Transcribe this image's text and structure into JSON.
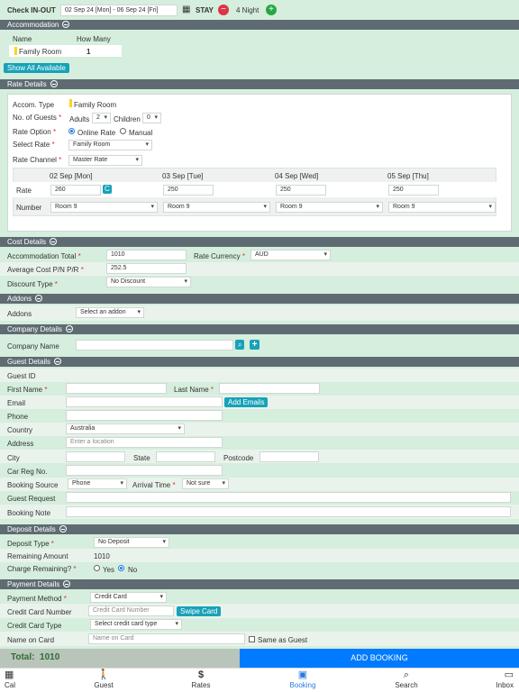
{
  "header": {
    "checkin_label": "Check IN-OUT",
    "dates": "02 Sep 24 [Mon] - 06 Sep 24 [Fri]",
    "stay_label": "STAY",
    "nights": "4 Night"
  },
  "accommodation": {
    "title": "Accommodation",
    "col_name": "Name",
    "col_count": "How Many",
    "room": "Family Room",
    "count": "1",
    "show_all": "Show All Available"
  },
  "rate_details": {
    "title": "Rate Details",
    "accom_type_label": "Accom. Type",
    "accom_type": "Family Room",
    "guests_label": "No. of Guests",
    "adults_label": "Adults",
    "adults": "2",
    "children_label": "Children",
    "children": "0",
    "rate_option_label": "Rate Option",
    "online_rate": "Online Rate",
    "manual": "Manual",
    "select_rate_label": "Select Rate",
    "select_rate": "Family Room",
    "channel_label": "Rate Channel",
    "channel": "Master Rate",
    "days": [
      "02 Sep [Mon]",
      "03 Sep [Tue]",
      "04 Sep [Wed]",
      "05 Sep [Thu]"
    ],
    "rate_label": "Rate",
    "rates": [
      "260",
      "250",
      "250",
      "250"
    ],
    "c_btn": "C",
    "number_label": "Number",
    "rooms": [
      "Room 9",
      "Room 9",
      "Room 9",
      "Room 9"
    ]
  },
  "cost": {
    "title": "Cost Details",
    "accom_total_label": "Accommodation Total",
    "accom_total": "1010",
    "currency_label": "Rate Currency",
    "currency": "AUD",
    "avg_label": "Average Cost P/N P/R",
    "avg": "252.5",
    "discount_label": "Discount Type",
    "discount": "No Discount"
  },
  "addons": {
    "title": "Addons",
    "label": "Addons",
    "select": "Select an addon"
  },
  "company": {
    "title": "Company Details",
    "label": "Company Name"
  },
  "guest": {
    "title": "Guest Details",
    "guest_id": "Guest ID",
    "first_name": "First Name",
    "last_name": "Last Name",
    "email": "Email",
    "add_emails": "Add Emails",
    "phone": "Phone",
    "country_label": "Country",
    "country": "Australia",
    "address_label": "Address",
    "address_ph": "Enter a location",
    "city": "City",
    "state": "State",
    "postcode": "Postcode",
    "car_reg": "Car Reg No.",
    "source_label": "Booking Source",
    "source": "Phone",
    "arrival_label": "Arrival Time",
    "arrival": "Not sure",
    "request": "Guest Request",
    "note": "Booking Note"
  },
  "deposit": {
    "title": "Deposit Details",
    "type_label": "Deposit Type",
    "type": "No Deposit",
    "remaining_label": "Remaining Amount",
    "remaining": "1010",
    "charge_label": "Charge Remaining?",
    "yes": "Yes",
    "no": "No"
  },
  "payment": {
    "title": "Payment Details",
    "method_label": "Payment Method",
    "method": "Credit Card",
    "cc_num_label": "Credit Card Number",
    "cc_num_ph": "Credit Card Number",
    "swipe": "Swipe Card",
    "cc_type_label": "Credit Card Type",
    "cc_type": "Select credit card type",
    "name_label": "Name on Card",
    "name_ph": "Name on Card",
    "same_as_guest": "Same as Guest"
  },
  "footer": {
    "total": "Total:  1010",
    "add_booking": "ADD BOOKING"
  },
  "nav": [
    {
      "label": "Cal",
      "icon": "calendar-icon"
    },
    {
      "label": "Guest",
      "icon": "walking-person-icon"
    },
    {
      "label": "Rates",
      "icon": "dollar-icon"
    },
    {
      "label": "Booking",
      "icon": "booking-calendar-icon"
    },
    {
      "label": "Search",
      "icon": "search-icon"
    },
    {
      "label": "Inbox",
      "icon": "inbox-icon"
    }
  ],
  "colors": {
    "section": "#5f6b72",
    "accent": "#17a2b8",
    "add_booking": "#007bff",
    "total_bar": "#b9c4bb",
    "nav_active": "#2a7ae2"
  }
}
